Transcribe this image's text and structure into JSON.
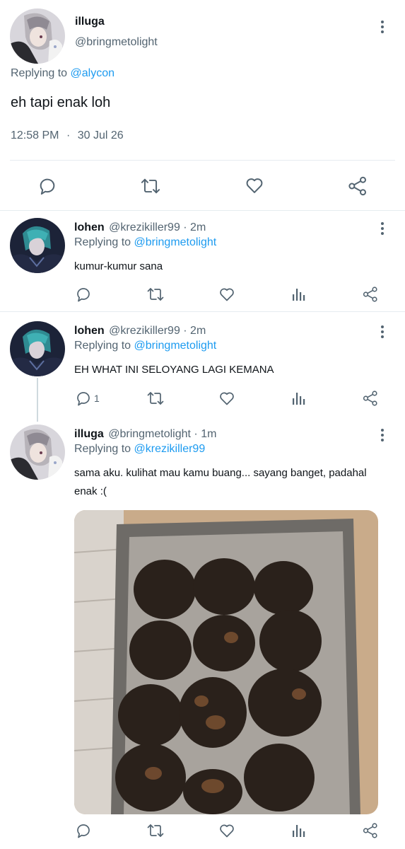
{
  "main_tweet": {
    "name": "illuga",
    "handle": "@bringmetolight",
    "replying_prefix": "Replying to ",
    "replying_to": "@alycon",
    "text": "eh tapi enak loh",
    "time": "12:58 PM",
    "dot": "·",
    "date": "30 Jul 26"
  },
  "replies": [
    {
      "name": "lohen",
      "handle_meta": "@krezikiller99 · 2m",
      "replying_prefix": "Replying to ",
      "replying_to": "@bringmetolight",
      "text": "kumur-kumur sana",
      "reply_count": ""
    },
    {
      "name": "lohen",
      "handle_meta": "@krezikiller99 · 2m",
      "replying_prefix": "Replying to ",
      "replying_to": "@bringmetolight",
      "text": "EH WHAT INI SELOYANG LAGI KEMANA",
      "reply_count": "1"
    },
    {
      "name": "illuga",
      "handle_meta": "@bringmetolight · 1m",
      "replying_prefix": "Replying to ",
      "replying_to": "@krezikiller99",
      "text": "sama aku. kulihat mau kamu buang... sayang banget, padahal enak :(",
      "reply_count": ""
    }
  ],
  "icons": {
    "reply": "reply-icon",
    "retweet": "retweet-icon",
    "like": "heart-icon",
    "views": "analytics-icon",
    "share": "share-icon",
    "more": "more-icon"
  },
  "colors": {
    "accent": "#1d9bf0",
    "secondary_text": "#536471",
    "divider": "#e6ecf0"
  }
}
